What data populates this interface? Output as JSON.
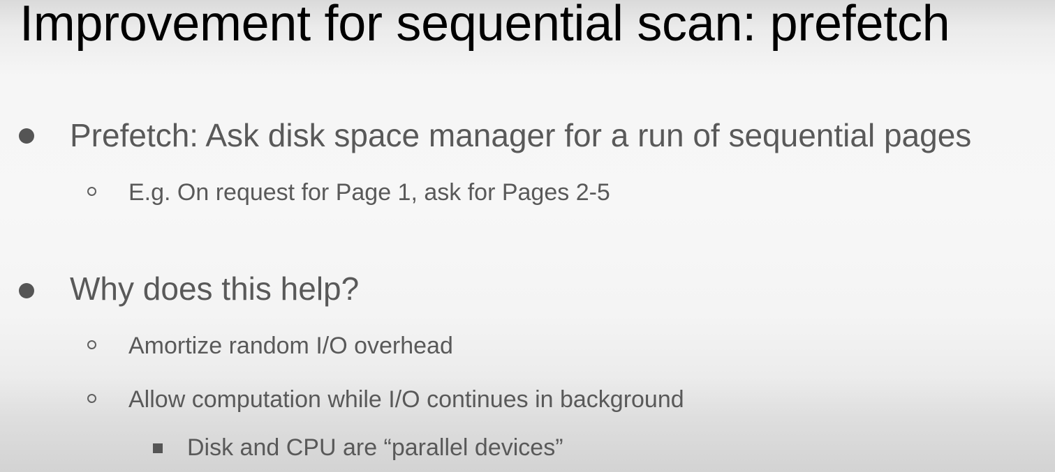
{
  "slide": {
    "title": "Improvement for sequential scan: prefetch",
    "bullets": [
      {
        "text": "Prefetch: Ask disk space manager for a run of sequential pages",
        "sub": [
          {
            "text": "E.g. On request for Page 1, ask for Pages 2-5"
          }
        ]
      },
      {
        "text": "Why does this help?",
        "sub": [
          {
            "text": "Amortize random I/O overhead"
          },
          {
            "text": "Allow computation while I/O continues in background",
            "sub": [
              {
                "text": "Disk and CPU are “parallel devices”"
              }
            ]
          }
        ]
      }
    ]
  }
}
